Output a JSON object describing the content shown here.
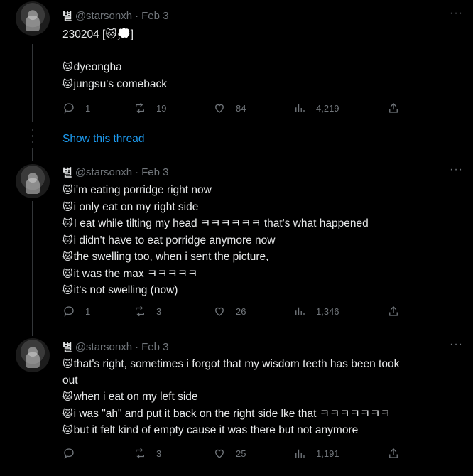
{
  "tweets": [
    {
      "display_name": "별",
      "handle": "@starsonxh",
      "separator": "·",
      "date": "Feb 3",
      "lines": [
        {
          "prefix": "",
          "text": "230204 [🐱💭]"
        },
        {
          "prefix": "",
          "text": ""
        },
        {
          "prefix": "🐱",
          "text": "dyeongha"
        },
        {
          "prefix": "🐱",
          "text": "jungsu's comeback"
        }
      ],
      "stats": {
        "replies": "1",
        "retweets": "19",
        "likes": "84",
        "views": "4,219"
      }
    },
    {
      "display_name": "별",
      "handle": "@starsonxh",
      "separator": "·",
      "date": "Feb 3",
      "lines": [
        {
          "prefix": "🐱",
          "text": "i'm eating porridge right now"
        },
        {
          "prefix": "🐱",
          "text": "i only eat on my right side"
        },
        {
          "prefix": "🐱",
          "text": "I eat while tilting my head ㅋㅋㅋㅋㅋㅋ that's what happened"
        },
        {
          "prefix": "🐱",
          "text": "i didn't have to eat porridge anymore now"
        },
        {
          "prefix": "🐱",
          "text": "the swelling too, when i sent the picture,"
        },
        {
          "prefix": "🐱",
          "text": "it was the max ㅋㅋㅋㅋㅋ"
        },
        {
          "prefix": "🐱",
          "text": "it's not swelling (now)"
        }
      ],
      "stats": {
        "replies": "1",
        "retweets": "3",
        "likes": "26",
        "views": "1,346"
      }
    },
    {
      "display_name": "별",
      "handle": "@starsonxh",
      "separator": "·",
      "date": "Feb 3",
      "lines": [
        {
          "prefix": "🐱",
          "text": "that's right, sometimes i forgot that my wisdom teeth has been took"
        },
        {
          "prefix": "",
          "text": "out"
        },
        {
          "prefix": "🐱",
          "text": "when i eat on my left side"
        },
        {
          "prefix": "🐱",
          "text": "i was \"ah\" and put it back on the right side lke that ㅋㅋㅋㅋㅋㅋㅋ"
        },
        {
          "prefix": "🐱",
          "text": "but it felt kind of empty cause it was there but not anymore"
        }
      ],
      "stats": {
        "replies": "",
        "retweets": "3",
        "likes": "25",
        "views": "1,191"
      }
    }
  ],
  "show_thread_label": "Show this thread",
  "more_label": "···",
  "icons": {
    "reply": "reply-icon",
    "retweet": "retweet-icon",
    "like": "heart-icon",
    "views": "analytics-icon",
    "share": "share-icon"
  },
  "colors": {
    "background": "#000000",
    "text": "#e7e9ea",
    "muted": "#71767b",
    "link": "#1d9bf0"
  }
}
